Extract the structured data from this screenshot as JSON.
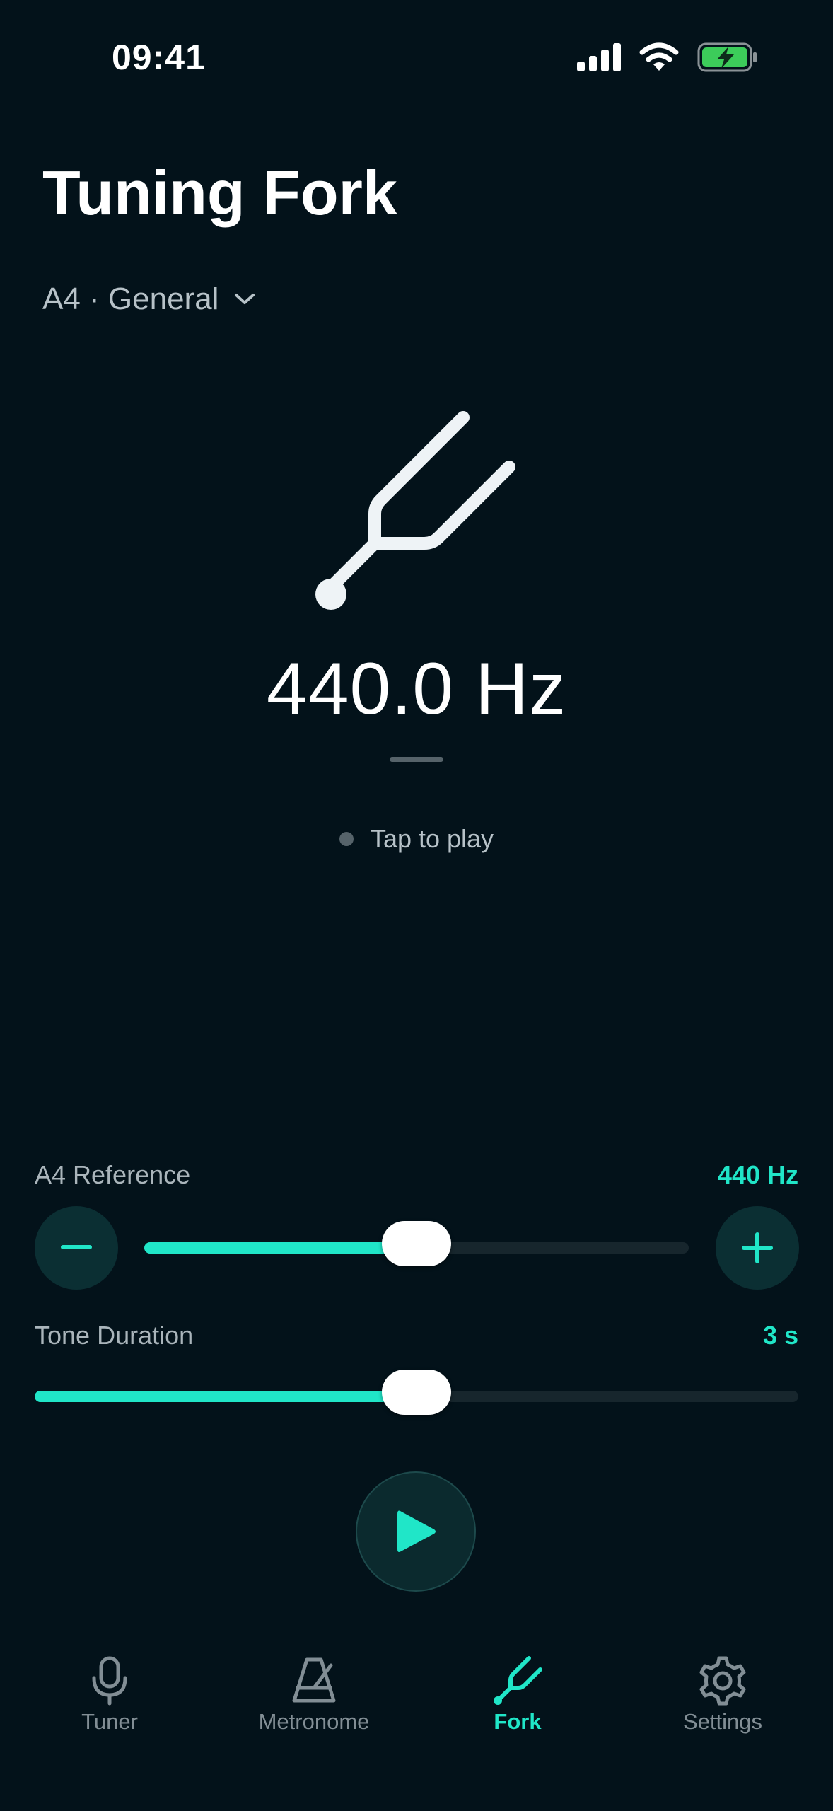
{
  "status_bar": {
    "time": "09:41",
    "icons": [
      "cellular-signal-icon",
      "wifi-icon",
      "battery-charging-icon"
    ]
  },
  "header": {
    "title": "Tuning Fork",
    "preset": "A4 · General"
  },
  "hero": {
    "icon": "tuning-fork-icon",
    "frequency": "440.0 Hz",
    "hint": "Tap to play"
  },
  "sliders": {
    "reference": {
      "label": "A4 Reference",
      "value": "440 Hz",
      "fraction": 0.5,
      "decrement_icon": "minus-icon",
      "increment_icon": "plus-icon"
    },
    "duration": {
      "label": "Tone Duration",
      "value": "3 s",
      "fraction": 0.5
    }
  },
  "play_button": {
    "icon": "play-icon"
  },
  "tabs": [
    {
      "label": "Tuner",
      "icon": "microphone-icon",
      "active": false
    },
    {
      "label": "Metronome",
      "icon": "metronome-icon",
      "active": false
    },
    {
      "label": "Fork",
      "icon": "tuning-fork-icon",
      "active": true
    },
    {
      "label": "Settings",
      "icon": "gear-icon",
      "active": false
    }
  ],
  "colors": {
    "background": "#03121a",
    "accent": "#20e6c8",
    "muted": "#828e95"
  }
}
